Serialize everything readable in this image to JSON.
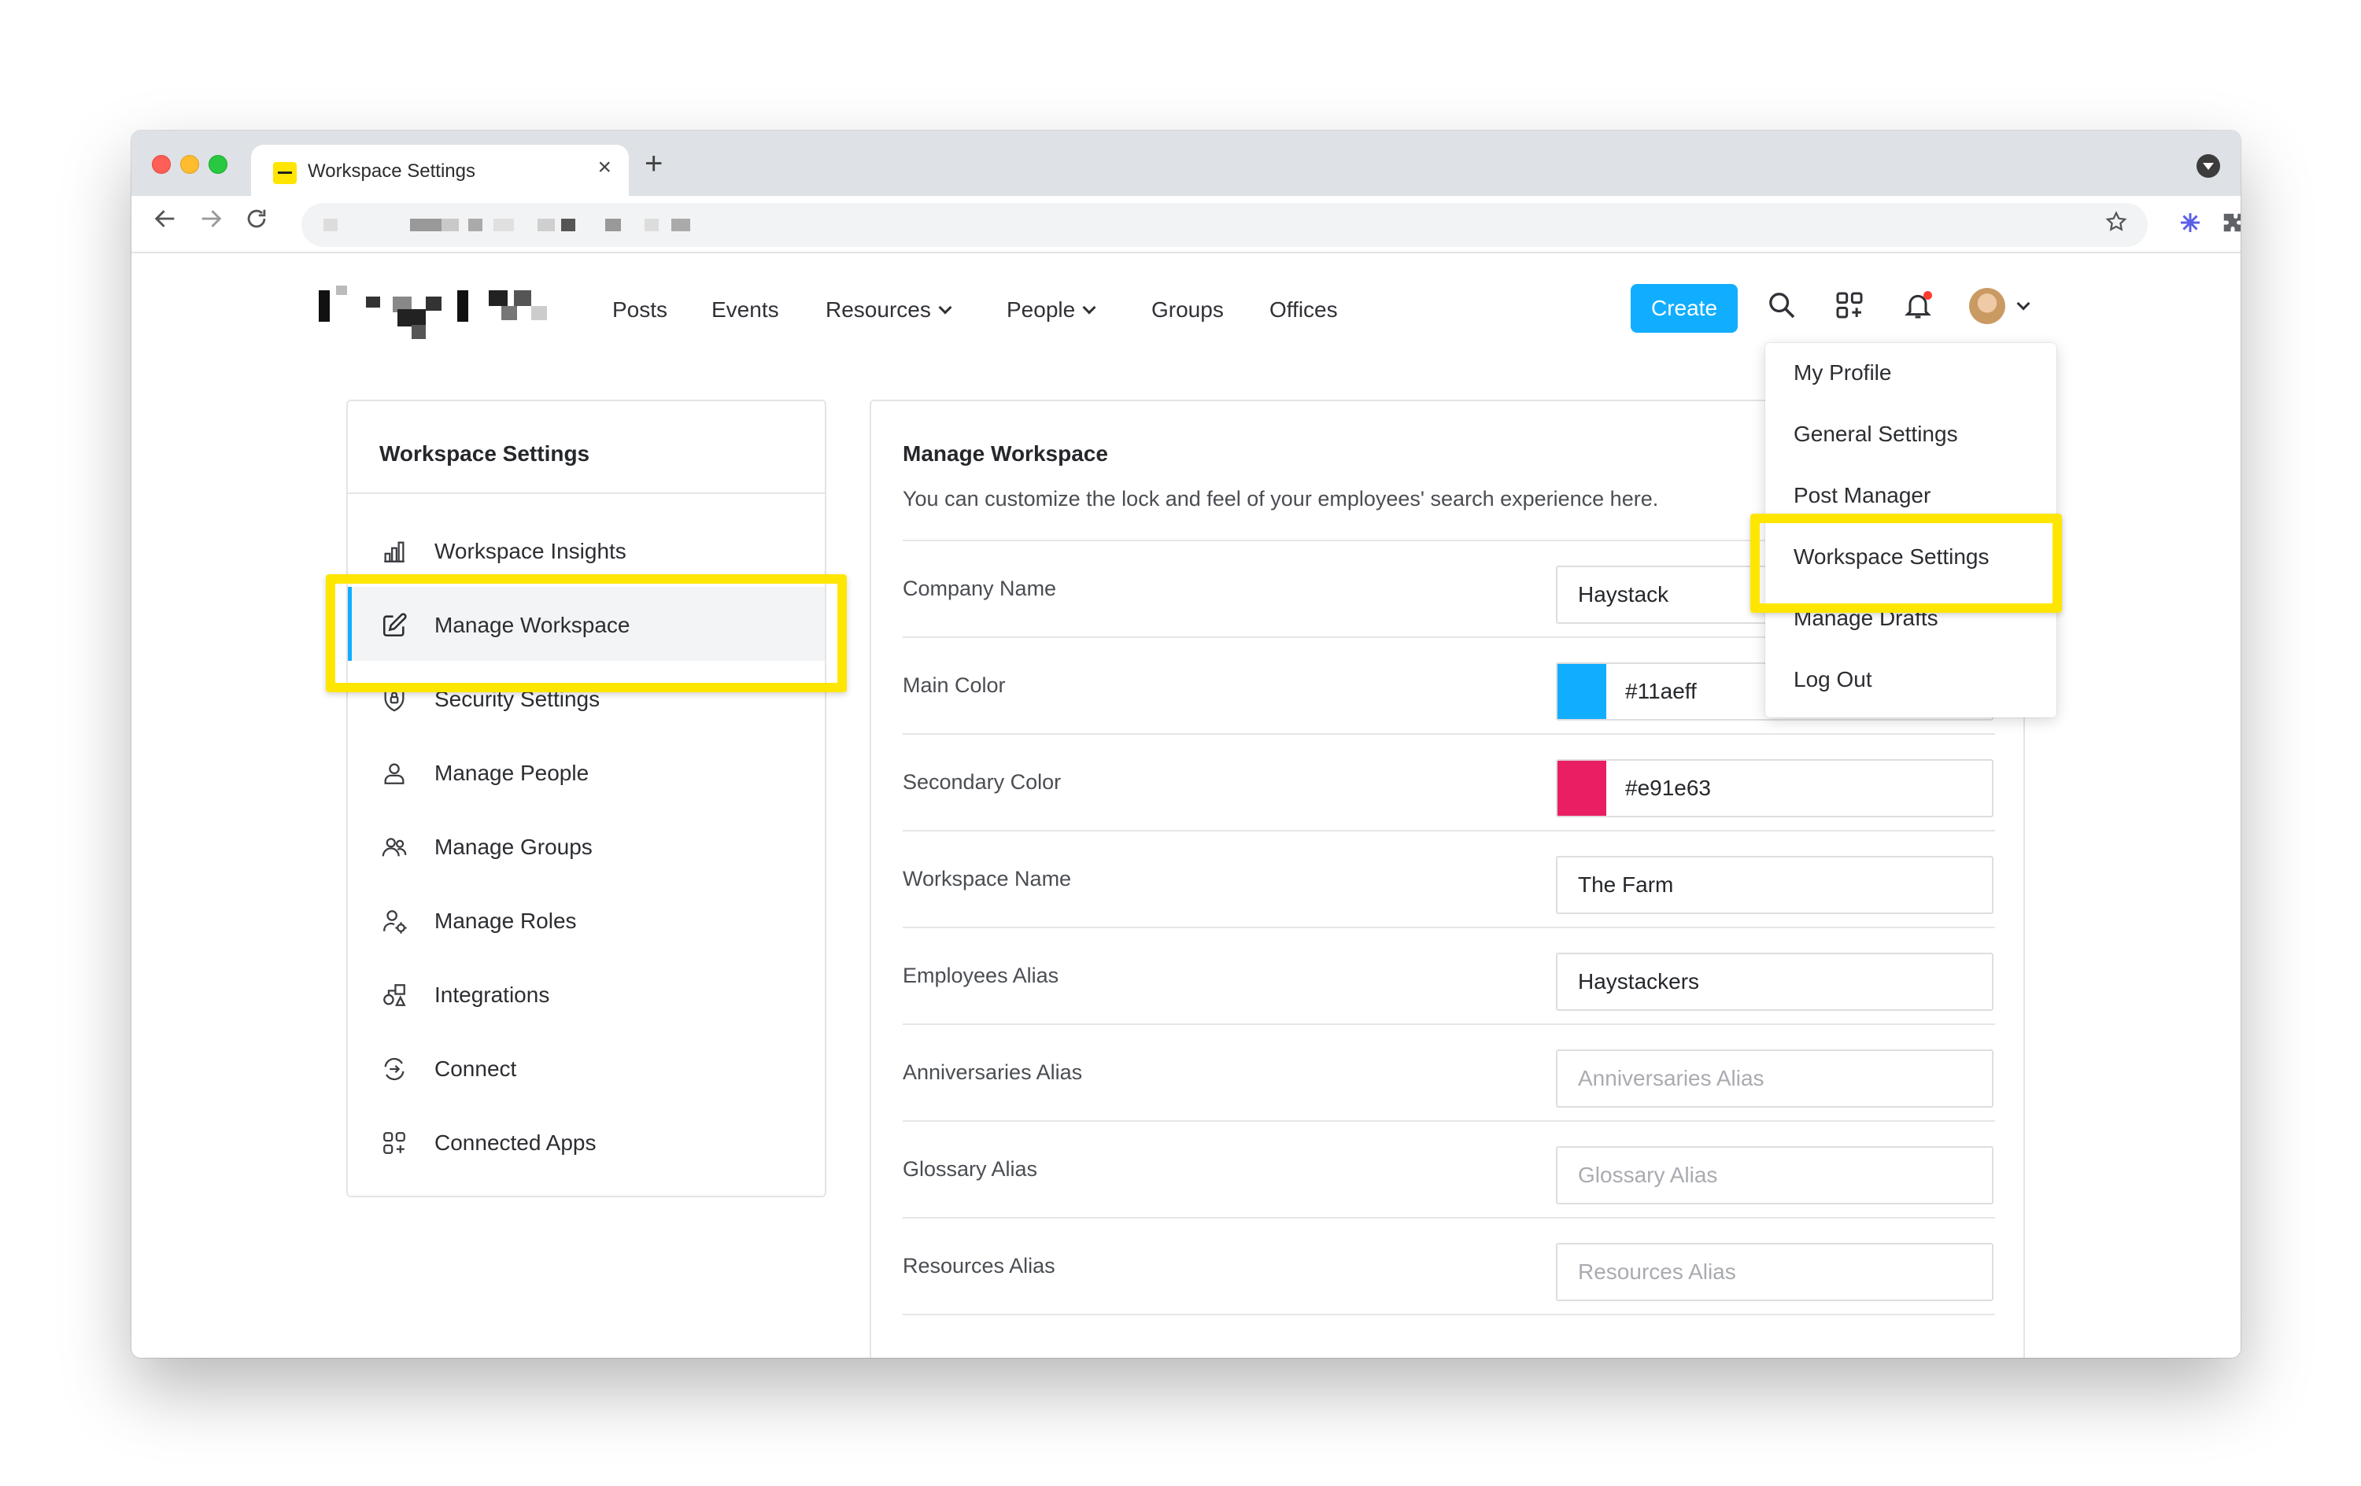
{
  "browser": {
    "tab_title": "Workspace Settings",
    "tab_close": "×",
    "new_tab": "+"
  },
  "header": {
    "nav": [
      "Posts",
      "Events",
      "Resources",
      "People",
      "Groups",
      "Offices"
    ],
    "create_label": "Create"
  },
  "user_menu": {
    "items": [
      "My Profile",
      "General Settings",
      "Post Manager",
      "Workspace Settings",
      "Manage Drafts",
      "Log Out"
    ],
    "highlighted": "Workspace Settings"
  },
  "sidebar": {
    "title": "Workspace Settings",
    "items": [
      {
        "label": "Workspace Insights",
        "icon": "bar-chart-icon"
      },
      {
        "label": "Manage Workspace",
        "icon": "edit-icon"
      },
      {
        "label": "Security Settings",
        "icon": "shield-icon"
      },
      {
        "label": "Manage People",
        "icon": "person-icon"
      },
      {
        "label": "Manage Groups",
        "icon": "group-icon"
      },
      {
        "label": "Manage Roles",
        "icon": "role-icon"
      },
      {
        "label": "Integrations",
        "icon": "integrations-icon"
      },
      {
        "label": "Connect",
        "icon": "connect-icon"
      },
      {
        "label": "Connected Apps",
        "icon": "apps-icon"
      }
    ],
    "active": "Manage Workspace"
  },
  "main": {
    "title": "Manage Workspace",
    "description": "You can customize the lock and feel of your employees' search experience here.",
    "fields": [
      {
        "label": "Company Name",
        "value": "Haystack",
        "placeholder": ""
      },
      {
        "label": "Main Color",
        "value": "#11aeff",
        "placeholder": "",
        "swatch": "#11aeff"
      },
      {
        "label": "Secondary Color",
        "value": "#e91e63",
        "placeholder": "",
        "swatch": "#e91e63"
      },
      {
        "label": "Workspace Name",
        "value": "The Farm",
        "placeholder": ""
      },
      {
        "label": "Employees Alias",
        "value": "Haystackers",
        "placeholder": ""
      },
      {
        "label": "Anniversaries Alias",
        "value": "",
        "placeholder": "Anniversaries Alias"
      },
      {
        "label": "Glossary Alias",
        "value": "",
        "placeholder": "Glossary Alias"
      },
      {
        "label": "Resources Alias",
        "value": "",
        "placeholder": "Resources Alias"
      }
    ]
  },
  "colors": {
    "accent": "#11aeff",
    "highlight": "#ffe600",
    "secondary": "#e91e63"
  }
}
